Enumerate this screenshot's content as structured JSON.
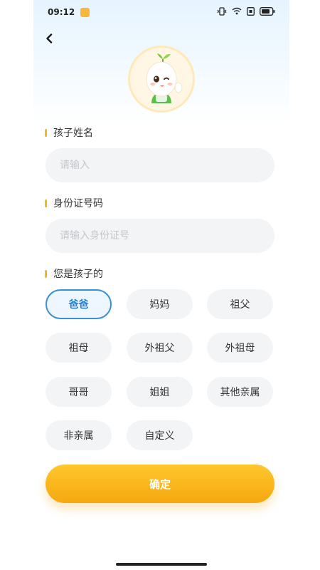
{
  "status_bar": {
    "time": "09:12",
    "icons": [
      "notification-app-icon",
      "vibrate-icon",
      "wifi-icon",
      "sim-icon",
      "battery-icon"
    ]
  },
  "nav": {
    "back_icon": "chevron-left-icon"
  },
  "avatar": {
    "icon": "mascot-avatar"
  },
  "form": {
    "name": {
      "label": "孩子姓名",
      "placeholder": "请输入",
      "value": ""
    },
    "id_card": {
      "label": "身份证号码",
      "placeholder": "请输入身份证号",
      "value": ""
    },
    "relation": {
      "label": "您是孩子的",
      "options": [
        "爸爸",
        "妈妈",
        "祖父",
        "祖母",
        "外祖父",
        "外祖母",
        "哥哥",
        "姐姐",
        "其他亲属",
        "非亲属",
        "自定义"
      ],
      "selected": "爸爸"
    },
    "confirm_label": "确定"
  },
  "colors": {
    "accent": "#f5b720",
    "selected": "#3a8fd6",
    "chip_bg": "#f3f4f6",
    "confirm_start": "#ffc72e",
    "confirm_end": "#f6a80f"
  }
}
